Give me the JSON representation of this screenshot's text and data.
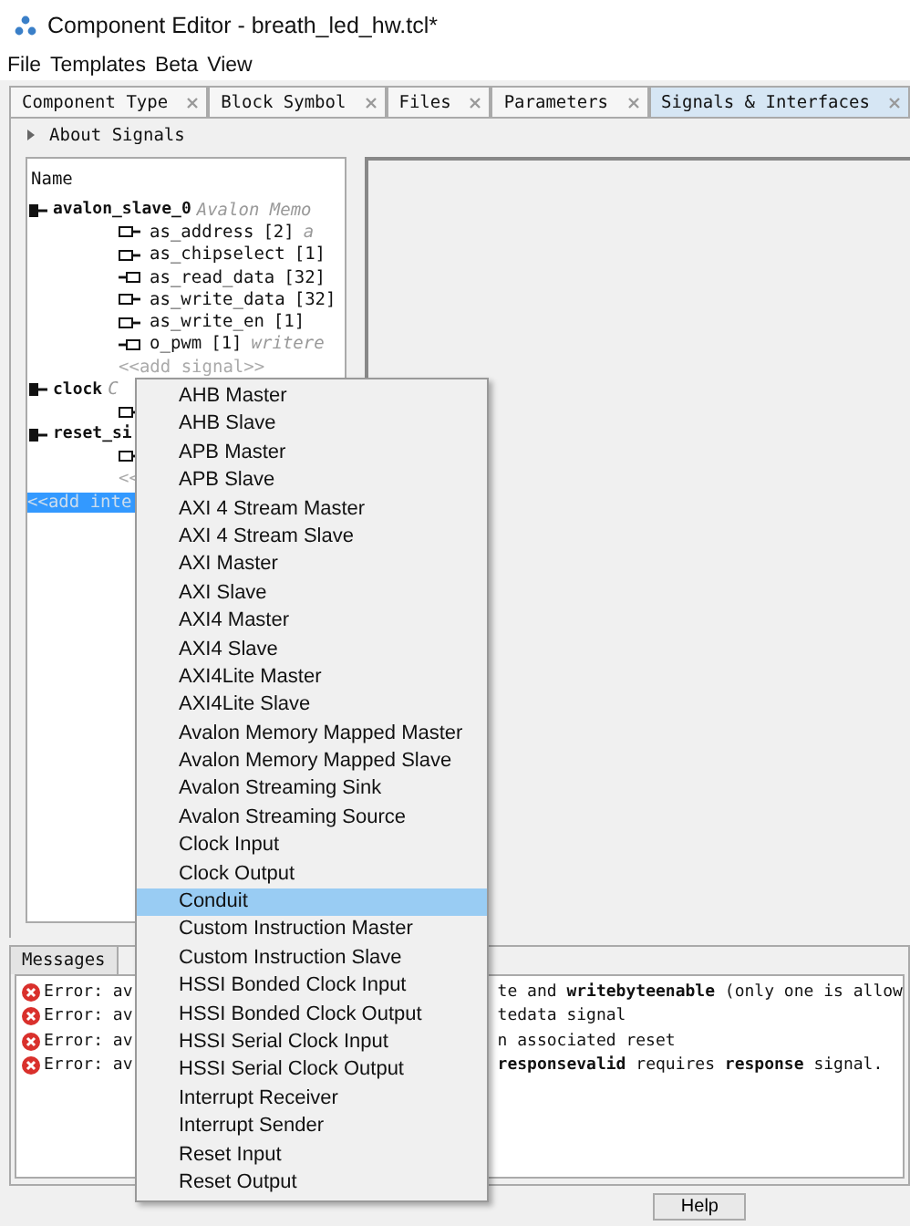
{
  "window": {
    "title": "Component Editor - breath_led_hw.tcl*"
  },
  "menu_bar": [
    "File",
    "Templates",
    "Beta",
    "View"
  ],
  "tabs": [
    {
      "label": "Component Type",
      "selected": false
    },
    {
      "label": "Block Symbol",
      "selected": false
    },
    {
      "label": "Files",
      "selected": false
    },
    {
      "label": "Parameters",
      "selected": false
    },
    {
      "label": "Signals & Interfaces",
      "selected": true
    }
  ],
  "about_section": {
    "label": "About Signals",
    "expanded": false
  },
  "tree": {
    "header": "Name",
    "rows": [
      {
        "kind": "interface",
        "name": "avalon_slave_0",
        "type": "Avalon Memo",
        "selected": false,
        "children": [
          {
            "kind": "signal",
            "output": false,
            "name": "as_address",
            "width": "[2]",
            "extra": "a"
          },
          {
            "kind": "signal",
            "output": false,
            "name": "as_chipselect",
            "width": "[1]"
          },
          {
            "kind": "signal",
            "output": true,
            "name": "as_read_data",
            "width": "[32]"
          },
          {
            "kind": "signal",
            "output": false,
            "name": "as_write_data",
            "width": "[32]"
          },
          {
            "kind": "signal",
            "output": false,
            "name": "as_write_en",
            "width": "[1]"
          },
          {
            "kind": "signal",
            "output": true,
            "name": "o_pwm",
            "width": "[1]",
            "extra": "writere"
          },
          {
            "kind": "add",
            "name": "<<add signal>>"
          }
        ]
      },
      {
        "kind": "interface",
        "name": "clock",
        "type": "C",
        "selected": false,
        "children": [
          {
            "kind": "signal",
            "output": false
          }
        ]
      },
      {
        "kind": "interface",
        "name": "reset_si",
        "selected": false,
        "children": [
          {
            "kind": "signal",
            "output": false
          },
          {
            "kind": "add",
            "name": "<<"
          }
        ]
      },
      {
        "kind": "add",
        "name": "<<add inte",
        "selected": true
      }
    ]
  },
  "context_menu": [
    {
      "label": "AHB Master",
      "selected": false
    },
    {
      "label": "AHB Slave",
      "selected": false
    },
    {
      "label": "APB Master",
      "selected": false
    },
    {
      "label": "APB Slave",
      "selected": false
    },
    {
      "label": "AXI 4 Stream Master",
      "selected": false
    },
    {
      "label": "AXI 4 Stream Slave",
      "selected": false
    },
    {
      "label": "AXI Master",
      "selected": false
    },
    {
      "label": "AXI Slave",
      "selected": false
    },
    {
      "label": "AXI4 Master",
      "selected": false
    },
    {
      "label": "AXI4 Slave",
      "selected": false
    },
    {
      "label": "AXI4Lite Master",
      "selected": false
    },
    {
      "label": "AXI4Lite Slave",
      "selected": false
    },
    {
      "label": "Avalon Memory Mapped Master",
      "selected": false
    },
    {
      "label": "Avalon Memory Mapped Slave",
      "selected": false
    },
    {
      "label": "Avalon Streaming Sink",
      "selected": false
    },
    {
      "label": "Avalon Streaming Source",
      "selected": false
    },
    {
      "label": "Clock Input",
      "selected": false
    },
    {
      "label": "Clock Output",
      "selected": false
    },
    {
      "label": "Conduit",
      "selected": true
    },
    {
      "label": "Custom Instruction Master",
      "selected": false
    },
    {
      "label": "Custom Instruction Slave",
      "selected": false
    },
    {
      "label": "HSSI Bonded Clock Input",
      "selected": false
    },
    {
      "label": "HSSI Bonded Clock Output",
      "selected": false
    },
    {
      "label": "HSSI Serial Clock Input",
      "selected": false
    },
    {
      "label": "HSSI Serial Clock Output",
      "selected": false
    },
    {
      "label": "Interrupt Receiver",
      "selected": false
    },
    {
      "label": "Interrupt Sender",
      "selected": false
    },
    {
      "label": "Reset Input",
      "selected": false
    },
    {
      "label": "Reset Output",
      "selected": false
    }
  ],
  "messages": {
    "tab": "Messages",
    "rows": [
      {
        "kind": "error",
        "start": "Error: av",
        "end": "te and **writebyteenable** (only one is allow"
      },
      {
        "kind": "error",
        "start": "Error: av",
        "end": "tedata signal"
      },
      {
        "kind": "error",
        "start": "Error: av",
        "end": "n associated reset"
      },
      {
        "kind": "error",
        "start": "Error: av",
        "end": "**responsevalid** requires **response** signal."
      }
    ]
  },
  "buttons": [
    "Help"
  ]
}
